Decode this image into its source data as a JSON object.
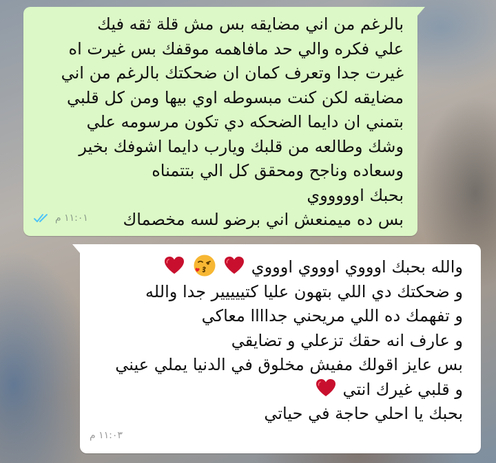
{
  "messages": {
    "sent": {
      "lines": [
        "بالرغم من اني مضايقه بس مش قلة ثقه فيك",
        "علي فكره والي حد مافاهمه موقفك بس غيرت اه",
        "غيرت جدا وتعرف كمان ان ضحكتك بالرغم من اني",
        "مضايقه لكن كنت مبسوطه اوي بيها ومن كل قلبي",
        "بتمني ان دايما الضحكه دي تكون مرسومه علي",
        "وشك وطالعه من قلبك ويارب دايما اشوفك بخير",
        "وسعاده وناجح ومحقق كل الي بتتمناه",
        "بحبك اوووووي",
        "بس ده ميمنعش اني برضو لسه مخصماك"
      ],
      "time": "١١:٠١ م",
      "status_icon": "double-check-read-icon",
      "check_color": "#4fc3f7"
    },
    "received": {
      "line1": "والله بحبك اوووي اوووي اوووي",
      "lines": [
        "و ضحكتك دي اللي بتهون عليا كتييييير جدا والله",
        "و تفهمك ده اللي مريحني جداااا معاكي",
        "و عارف انه حقك تزعلي و تضايقي",
        "بس عايز اقولك مفيش مخلوق في الدنيا يملي عيني"
      ],
      "line6": "و قلبي غيرك انتي",
      "line7": "بحبك يا احلي حاجة في حياتي",
      "time": "١١:٠٣ م",
      "emojis": [
        "red-heart-icon",
        "face-blowing-kiss-icon",
        "red-heart-icon"
      ]
    }
  },
  "colors": {
    "sent_bubble": "#dcf8c6",
    "received_bubble": "#ffffff",
    "heart": "#c8102e"
  }
}
